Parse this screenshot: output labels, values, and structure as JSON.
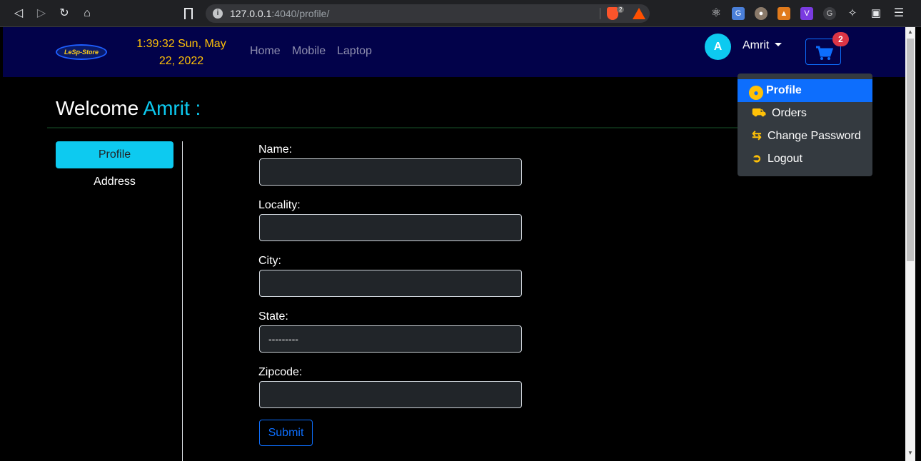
{
  "browser": {
    "url_host": "127.0.0.1",
    "url_path": ":4040/profile/",
    "brave_shield_count": "2"
  },
  "navbar": {
    "logo_text": "LeSp-Store",
    "clock_line1": "1:39:32 Sun, May",
    "clock_line2": "22, 2022",
    "links": [
      "Home",
      "Mobile",
      "Laptop"
    ],
    "avatar_letter": "A",
    "username": "Amrit",
    "cart_count": "2"
  },
  "welcome": {
    "prefix": "Welcome",
    "name": "Amrit :"
  },
  "sidebar": {
    "tabs": [
      "Profile",
      "Address"
    ]
  },
  "form": {
    "fields": [
      {
        "label": "Name:",
        "value": ""
      },
      {
        "label": "Locality:",
        "value": ""
      },
      {
        "label": "City:",
        "value": ""
      },
      {
        "label": "State:",
        "value": "---------"
      },
      {
        "label": "Zipcode:",
        "value": ""
      }
    ],
    "submit_label": "Submit"
  },
  "dropdown": {
    "items": [
      "Profile",
      "Orders",
      "Change Password",
      "Logout"
    ]
  },
  "colors": {
    "navbar_bg": "#02024a",
    "accent_cyan": "#0dcaf0",
    "primary_blue": "#0d6efd",
    "warning_yellow": "#ffc107",
    "badge_red": "#dc3545"
  }
}
